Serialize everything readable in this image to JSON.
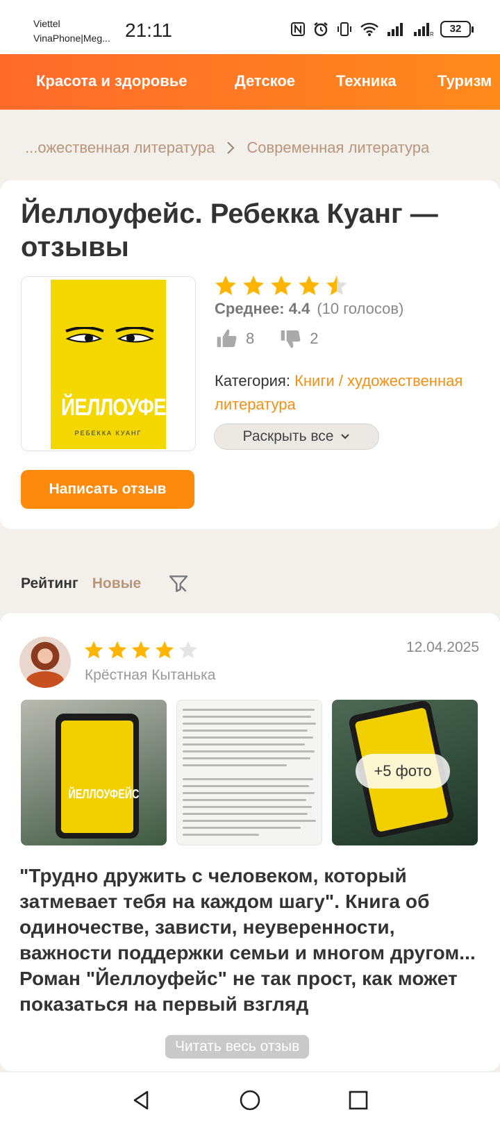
{
  "status_bar": {
    "carrier_line1": "Viettel",
    "carrier_line2": "VinaPhone|Meg...",
    "time": "21:11",
    "battery": "32"
  },
  "categories": [
    "Красота и здоровье",
    "Детское",
    "Техника",
    "Туризм"
  ],
  "breadcrumb": {
    "parent": "...ожественная литература",
    "current": "Современная литература"
  },
  "product": {
    "title": "Йеллоуфейс. Ребекка Куанг — отзывы",
    "cover": {
      "title": "ЙЕЛЛОУФЕЙС",
      "author": "РЕБЕККА КУАНГ"
    },
    "rating_value": 4.4,
    "average_label": "Среднее: 4.4",
    "votes": "(10 голосов)",
    "likes": "8",
    "dislikes": "2",
    "category_label": "Категория:",
    "category_link": "Книги / художественная литература",
    "expand_label": "Раскрыть все",
    "write_review_label": "Написать отзыв"
  },
  "sort": {
    "active": "Рейтинг",
    "inactive": "Новые"
  },
  "review": {
    "rating": 4,
    "author": "Крёстная Кытанька",
    "date": "12.04.2025",
    "more_photos": "+5 фото",
    "text": "\"Трудно дружить с человеком, который затмевает тебя на каждом шагу\". Книга об одиночестве, зависти, неуверенности, важности поддержки семьи и многом другом... Роман \"Йеллоуфейс\" не так прост, как может показаться на первый взгляд",
    "read_more": "Читать весь отзыв",
    "photo_cover_title": "ЙЕЛЛОУФЕЙС"
  },
  "colors": {
    "accent_orange": "#fd8a0c",
    "star": "#ffb400",
    "link": "#f39014"
  }
}
